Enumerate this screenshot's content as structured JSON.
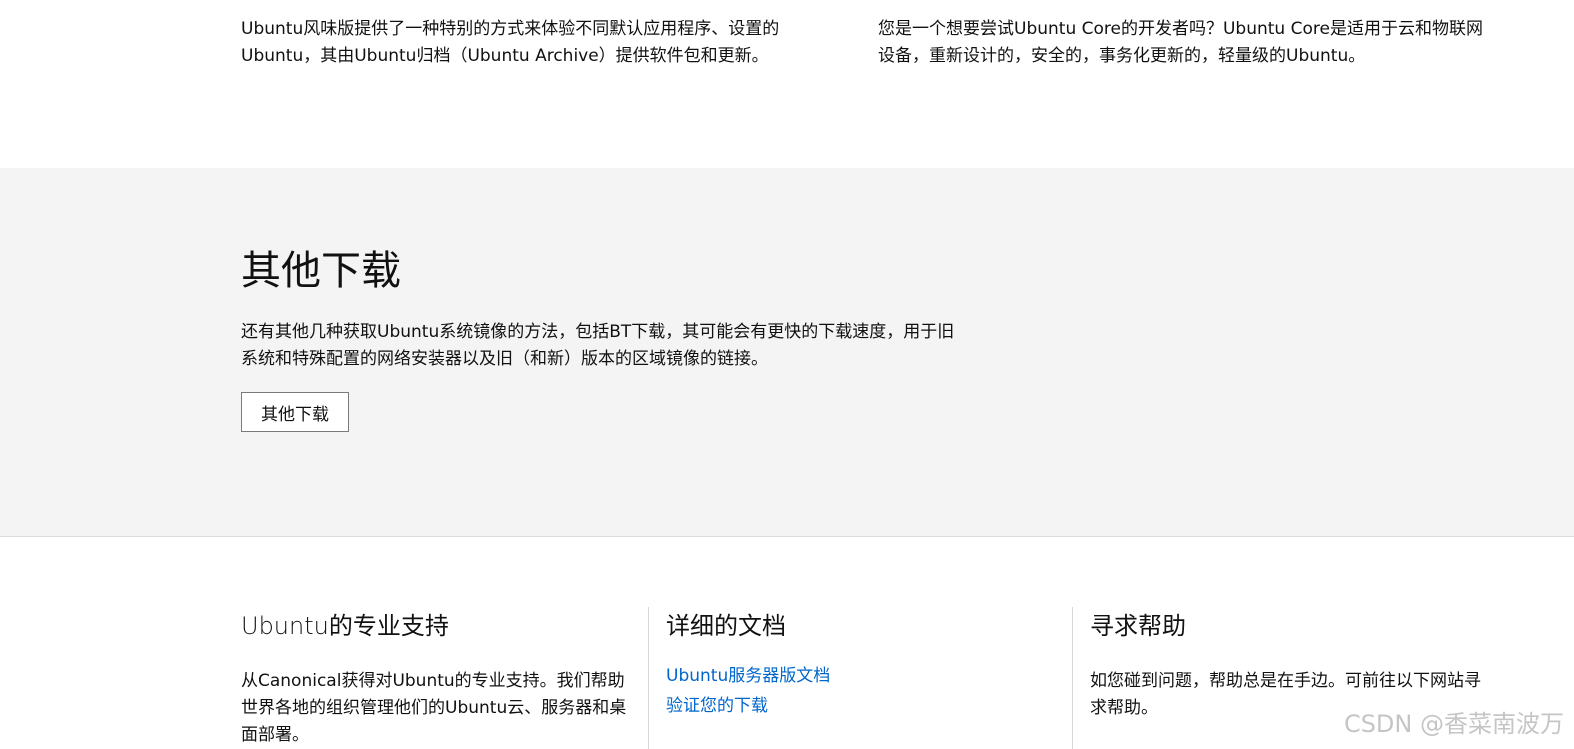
{
  "top": {
    "left_text": "Ubuntu风味版提供了一种特别的方式来体验不同默认应用程序、设置的Ubuntu，其由Ubuntu归档（Ubuntu Archive）提供软件包和更新。",
    "right_text": "您是一个想要尝试Ubuntu Core的开发者吗？Ubuntu Core是适用于云和物联网设备，重新设计的，安全的，事务化更新的，轻量级的Ubuntu。"
  },
  "other_downloads": {
    "title": "其他下载",
    "description": "还有其他几种获取Ubuntu系统镜像的方法，包括BT下载，其可能会有更快的下载速度，用于旧系统和特殊配置的网络安装器以及旧（和新）版本的区域镜像的链接。",
    "button_label": "其他下载"
  },
  "footer": {
    "support": {
      "title": "Ubuntu的专业支持",
      "text": "从Canonical获得对Ubuntu的专业支持。我们帮助世界各地的组织管理他们的Ubuntu云、服务器和桌面部署。"
    },
    "docs": {
      "title": "详细的文档",
      "links": [
        "Ubuntu服务器版文档",
        "验证您的下载"
      ]
    },
    "help": {
      "title": "寻求帮助",
      "text": "如您碰到问题，帮助总是在手边。可前往以下网站寻求帮助。"
    }
  },
  "watermark": "CSDN @香菜南波万",
  "colors": {
    "grey_bg": "#f4f4f4",
    "link": "#0066cc",
    "text": "#111111"
  }
}
